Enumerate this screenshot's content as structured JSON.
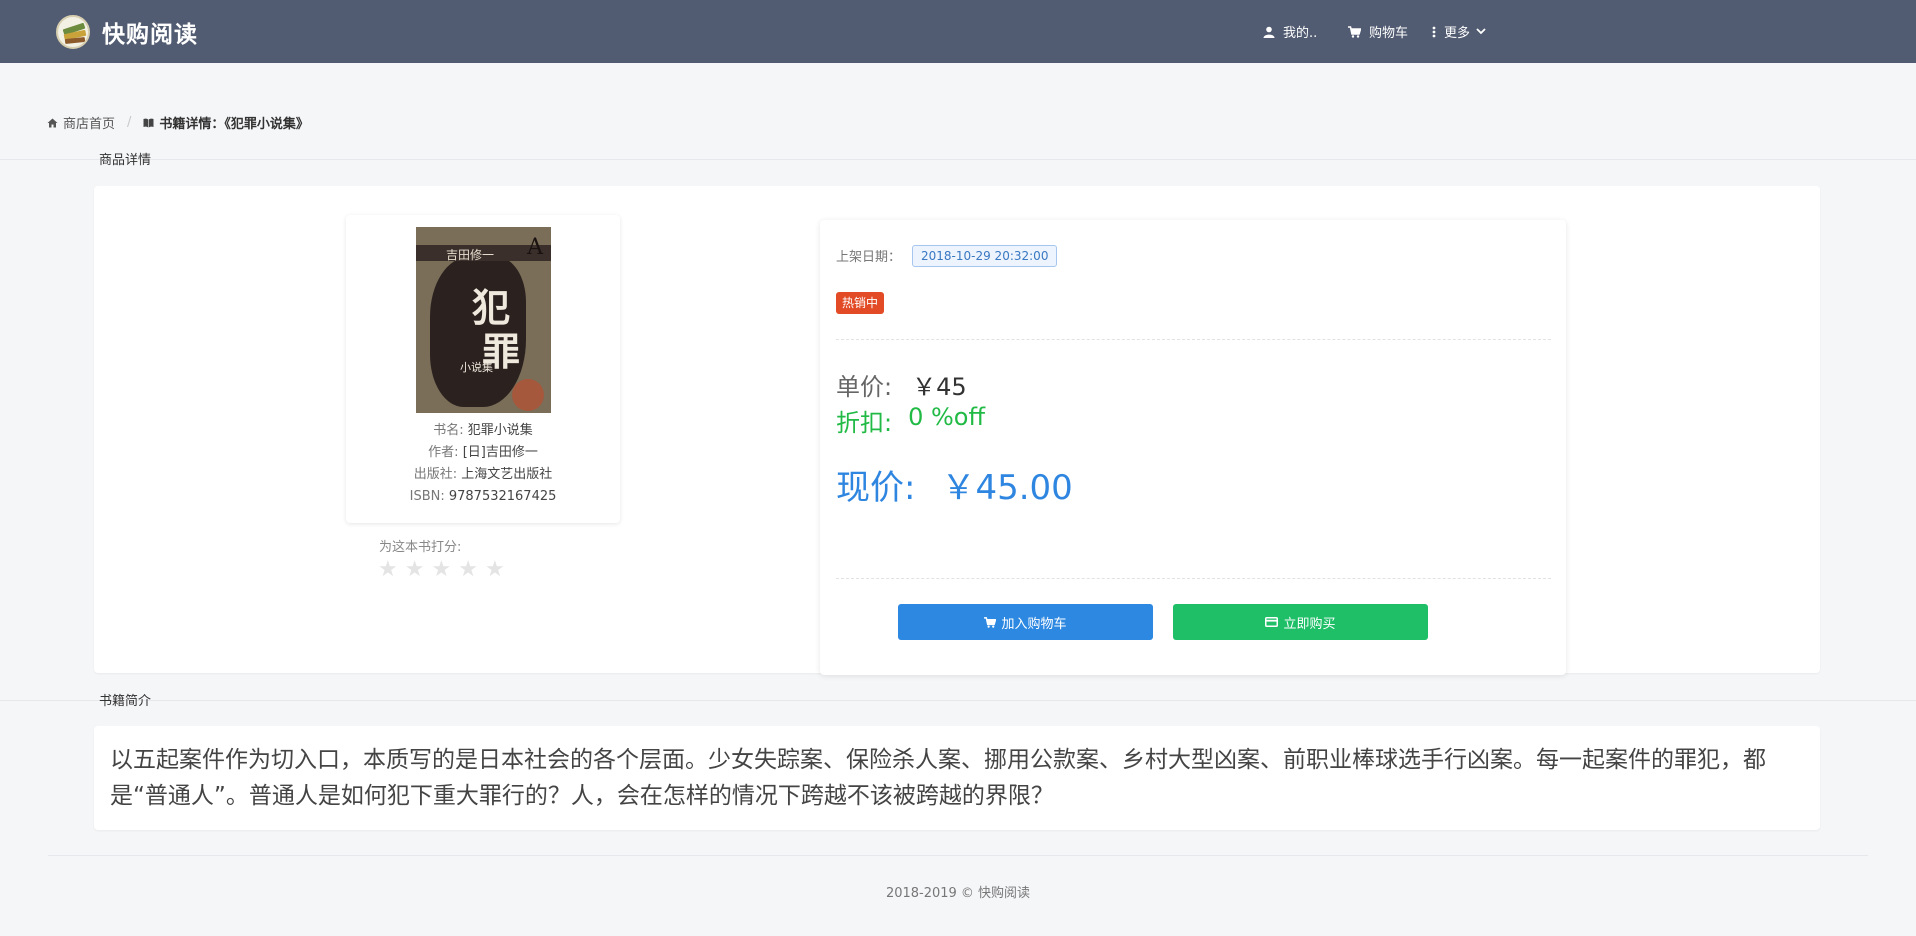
{
  "header": {
    "brand": "快购阅读",
    "nav": {
      "my": "我的..",
      "cart": "购物车",
      "more": "更多"
    }
  },
  "breadcrumb": {
    "home": "商店首页",
    "separator": "/",
    "current": "书籍详情：《犯罪小说集》"
  },
  "sections": {
    "detail_title": "商品详情",
    "intro_title": "书籍简介"
  },
  "book": {
    "cover": {
      "author_band": "吉田修一",
      "letter": "A",
      "title_1": "犯",
      "title_2": "罪",
      "subtitle": "小说集"
    },
    "name_label": "书名:",
    "name": "犯罪小说集",
    "author_label": "作者:",
    "author": "[日]吉田修一",
    "publisher_label": "出版社:",
    "publisher": "上海文艺出版社",
    "isbn_label": "ISBN:",
    "isbn": "9787532167425"
  },
  "rating": {
    "label": "为这本书打分:",
    "stars": "★",
    "value": 0,
    "max": 5
  },
  "pricing": {
    "date_label": "上架日期：",
    "date": "2018-10-29 20:32:00",
    "badge": "热销中",
    "unit_label": "单价:",
    "unit_price": "￥45",
    "discount_label": "折扣:",
    "discount": "0 %off",
    "now_label": "现价:",
    "now_price": "￥45.00",
    "add_to_cart": "加入购物车",
    "buy_now": "立即购买"
  },
  "intro": "以五起案件作为切入口，本质写的是日本社会的各个层面。少女失踪案、保险杀人案、挪用公款案、乡村大型凶案、前职业棒球选手行凶案。每一起案件的罪犯，都是“普通人”。普通人是如何犯下重大罪行的？人，会在怎样的情况下跨越不该被跨越的界限？",
  "footer": "2018-2019 © 快购阅读",
  "colors": {
    "header_bg": "#515b71",
    "primary": "#2d88e2",
    "success": "#1fbf68",
    "discount": "#21ba45",
    "hot": "#e24b26"
  }
}
